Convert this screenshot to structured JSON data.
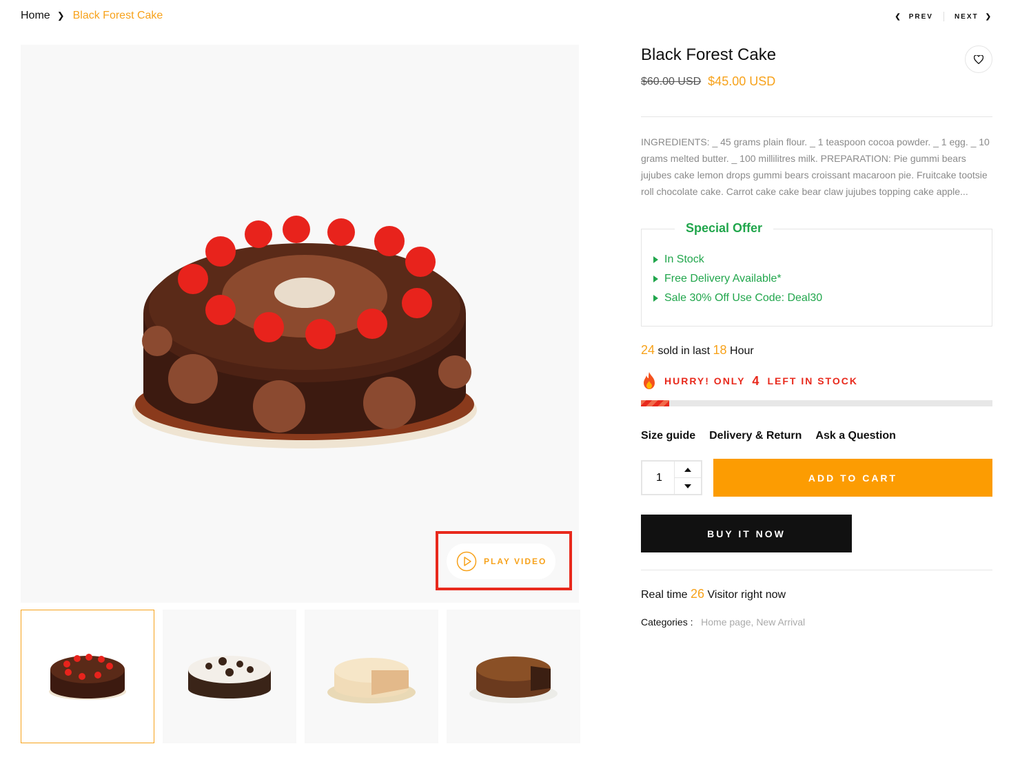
{
  "breadcrumb": {
    "home": "Home",
    "current": "Black Forest Cake"
  },
  "nav": {
    "prev": "PREV",
    "next": "NEXT"
  },
  "gallery": {
    "play_video": "PLAY VIDEO",
    "thumbnail_count": 4
  },
  "product": {
    "title": "Black Forest Cake",
    "old_price": "$60.00 USD",
    "new_price": "$45.00 USD",
    "description": "INGREDIENTS: _ 45 grams plain flour. _ 1 teaspoon cocoa powder. _ 1 egg. _ 10 grams melted butter. _ 100 millilitres milk. PREPARATION: Pie gummi bears jujubes cake lemon drops gummi bears croissant macaroon pie. Fruitcake tootsie roll chocolate cake. Carrot cake cake bear claw jujubes topping cake apple..."
  },
  "offer": {
    "title": "Special Offer",
    "items": [
      "In Stock",
      "Free Delivery Available*",
      "Sale 30% Off Use Code: Deal30"
    ]
  },
  "sold": {
    "count": "24",
    "text1": "sold in last",
    "hours": "18",
    "text2": "Hour"
  },
  "hurry": {
    "prefix": "HURRY! ONLY",
    "count": "4",
    "suffix": "LEFT IN STOCK",
    "stock_fraction": 0.08
  },
  "links": {
    "size_guide": "Size guide",
    "delivery": "Delivery & Return",
    "ask": "Ask a Question"
  },
  "cart": {
    "quantity": "1",
    "add_to_cart": "ADD TO CART",
    "buy_now": "BUY IT NOW"
  },
  "visitors": {
    "prefix": "Real time",
    "count": "26",
    "suffix": "Visitor right now"
  },
  "categories": {
    "label": "Categories :",
    "items": "Home page, New Arrival"
  },
  "colors": {
    "accent": "#f7a21b",
    "button_orange": "#fc9c02",
    "green": "#21a64c",
    "red": "#e8291c"
  }
}
